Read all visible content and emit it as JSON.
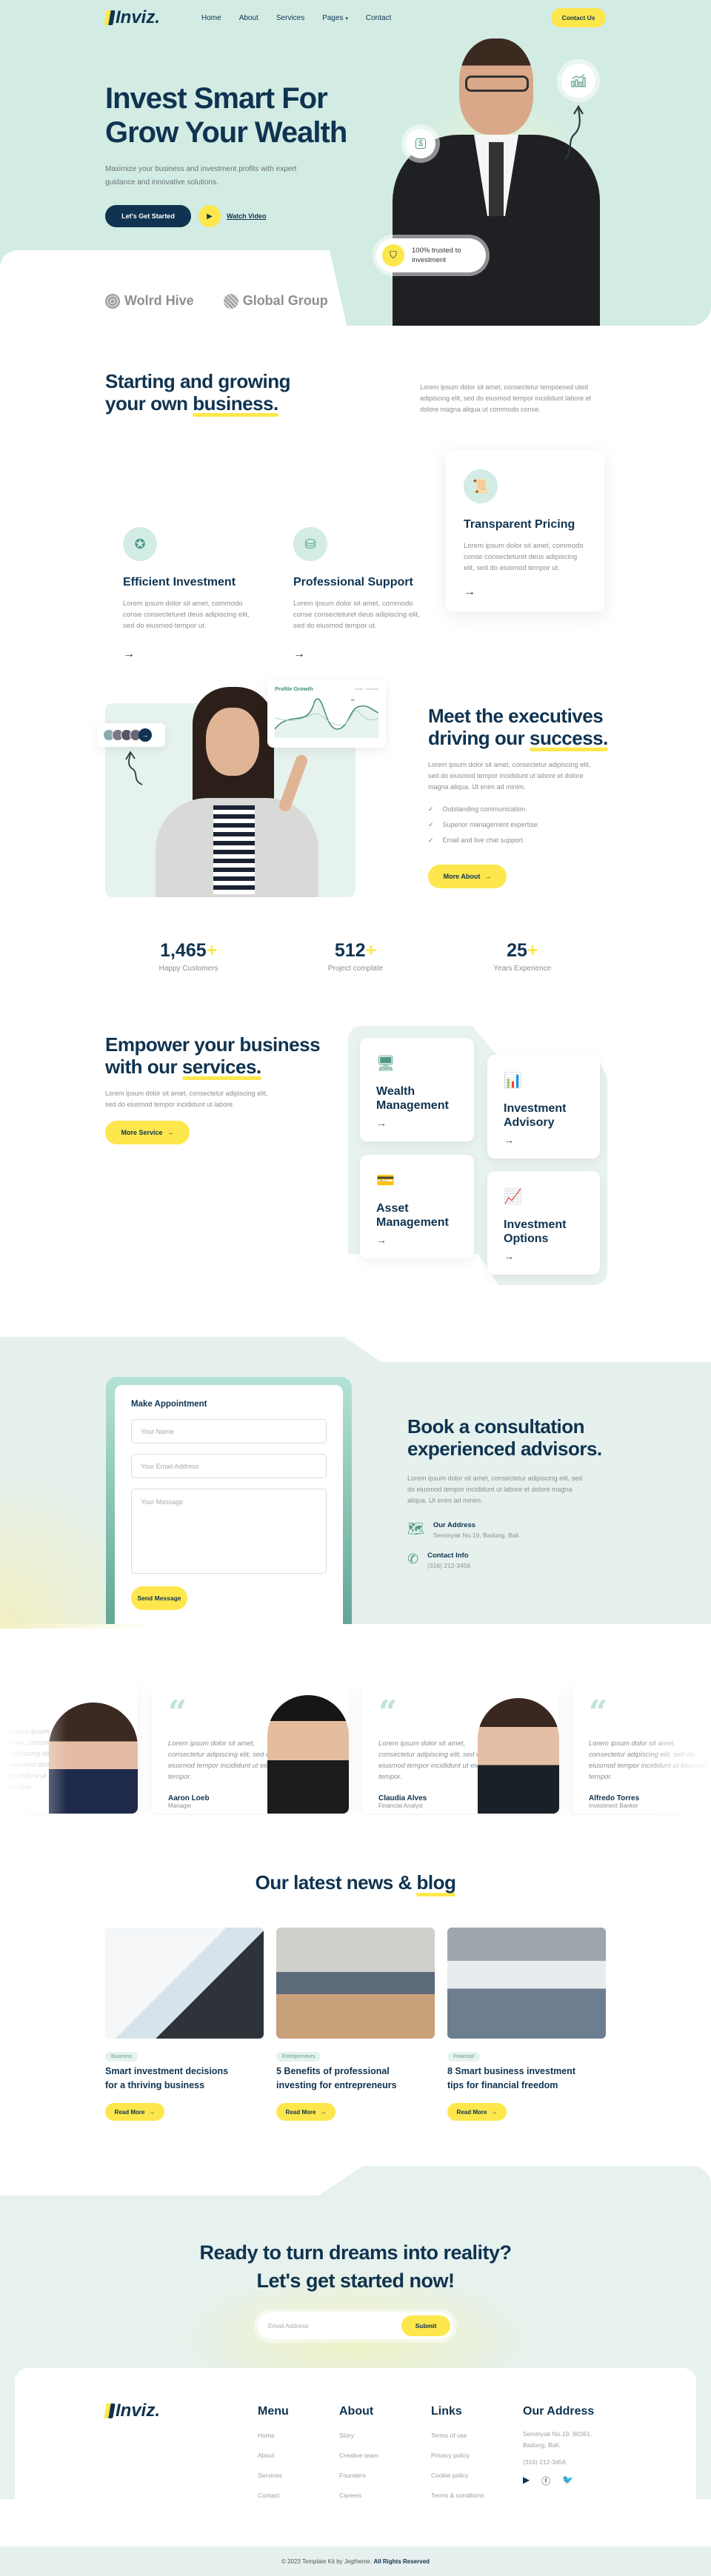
{
  "nav": {
    "brand": "Inviz.",
    "items": [
      "Home",
      "About",
      "Services",
      "Pages",
      "Contact"
    ],
    "cta": "Contact Us"
  },
  "hero": {
    "title_line1": "Invest Smart For",
    "title_line2_pre": "Grow Your ",
    "title_line2_hl": "Wealth",
    "subtitle": "Maximize your business and investment profits with expert guidance and innovative solutions.",
    "primary_btn": "Let's Get Started",
    "video_btn": "Watch Video",
    "trust_badge": "100% trusted to investment",
    "partners": [
      "Wolrd Hive",
      "Global Group"
    ]
  },
  "intro": {
    "title_line1": "Starting and growing",
    "title_line2_pre": "your own ",
    "title_line2_hl": "business.",
    "text": "Lorem ipsum dolor sit amet, consectetur tempoesed uted adipiscing elit, sed do eiusmod tempor incididunt labore et dolore magna aliqua ut commodo conse."
  },
  "features": [
    {
      "title": "Efficient Investment",
      "text": "Lorem ipsum dolor sit amet, commodo conse consecteturet deus adipiscing elit, sed do eiusmod tempor ut.",
      "icon": "laurel-star-icon"
    },
    {
      "title": "Professional Support",
      "text": "Lorem ipsum dolor sit amet, commodo conse consecteturet deus adipiscing elit, sed do eiusmod tempor ut.",
      "icon": "coins-icon"
    },
    {
      "title": "Transparent Pricing",
      "text": "Lorem ipsum dolor sit amet, commodo conse consecteturet deus adipiscing elit, sed do eiusmod tempor ut.",
      "icon": "certificate-icon"
    }
  ],
  "executives": {
    "chart_title": "Profile Growth",
    "chart_legend": [
      "Today",
      "Yesterday"
    ],
    "chart_point_label": "28",
    "title_line1": "Meet the executives",
    "title_line2_pre": "driving our ",
    "title_line2_hl": "success.",
    "text": "Lorem ipsum dolor sit amet, consectetur adipiscing elit, sed do eiusmod tempor incididunt ut labore et dolore magna aliqua. Ut enim ad minim.",
    "checks": [
      "Outstanding communication.",
      "Superior management expertise.",
      "Email and live chat support."
    ],
    "button": "More About"
  },
  "stats": [
    {
      "value": "1,465",
      "suffix": "+",
      "label": "Happy Customers"
    },
    {
      "value": "512",
      "suffix": "+",
      "label": "Project complate"
    },
    {
      "value": "25",
      "suffix": "+",
      "label": "Years Experience"
    }
  ],
  "services": {
    "title_line1": "Empower your business",
    "title_line2_pre": "with our ",
    "title_line2_hl": "services.",
    "text": "Lorem ipsum dolor sit amet, consectetur adipiscing elit, sed do eiusmod tempor incididunt ut labore.",
    "button": "More Service",
    "cards": [
      {
        "title": "Wealth Management",
        "icon": "monitor-dollar-icon"
      },
      {
        "title": "Investment Advisory",
        "icon": "presentation-chart-icon"
      },
      {
        "title": "Asset Management",
        "icon": "credit-card-icon"
      },
      {
        "title": "Investment Options",
        "icon": "growth-chart-icon"
      }
    ]
  },
  "appointment": {
    "form_title": "Make Appointment",
    "name_placeholder": "Your Name",
    "email_placeholder": "Your Email Address",
    "message_placeholder": "Your Massage",
    "submit": "Send Message",
    "title_line1_pre": "Book a ",
    "title_line1_hl": "consultation",
    "title_line2": "experienced advisors.",
    "text": "Lorem ipsum dolor sit amet, consectetur adipiscing elit, sed do eiusmod tempor incididunt ut labore et dolore magna aliqua. Ut enim ad minim.",
    "address_label": "Our Address",
    "address_value": "Seminyak No.19, Badung, Bali.",
    "contact_label": "Contact Info",
    "contact_value": "(316) 212-3456"
  },
  "testimonials": [
    {
      "quote": "Lorem ipsum dolor sit amet, consectetur adipiscing elit, sed do eiusmod tempor incididunt ut eiusmod tempor.",
      "name": "",
      "role": ""
    },
    {
      "quote": "Lorem ipsum dolor sit amet, consectetur adipiscing elit, sed do eiusmod tempor incididunt ut eiusmod tempor.",
      "name": "Aaron Loeb",
      "role": "Manager"
    },
    {
      "quote": "Lorem ipsum dolor sit amet, consectetur adipiscing elit, sed do eiusmod tempor incididunt ut eiusmod tempor.",
      "name": "Claudia Alves",
      "role": "Financial Analyst"
    },
    {
      "quote": "Lorem ipsum dolor sit amet, consectetur adipiscing elit, sed do eiusmod tempor incididunt ut eiusmod tempor.",
      "name": "Alfredo Torres",
      "role": "Investment Banker"
    }
  ],
  "blog": {
    "title_pre": "Our latest news & ",
    "title_hl": "blog",
    "read_more": "Read More",
    "posts": [
      {
        "tag": "Business",
        "title": "Smart investment decisions for a thriving business"
      },
      {
        "tag": "Entrepreneurs",
        "title": "5 Benefits of professional investing for entrepreneurs"
      },
      {
        "tag": "Financial",
        "title": "8 Smart business investment tips for financial freedom"
      }
    ]
  },
  "cta": {
    "line1": "Ready to turn dreams into reality?",
    "line2_pre": "Let's get started ",
    "line2_hl": "now!",
    "email_placeholder": "Email Address",
    "submit": "Submit"
  },
  "footer": {
    "brand": "Inviz.",
    "columns": [
      {
        "title": "Menu",
        "links": [
          "Home",
          "About",
          "Services",
          "Contact"
        ]
      },
      {
        "title": "About",
        "links": [
          "Story",
          "Creative team",
          "Founders",
          "Careers"
        ]
      },
      {
        "title": "Links",
        "links": [
          "Terms of use",
          "Privacy policy",
          "Cookie policy",
          "Terms & conditions"
        ]
      }
    ],
    "address_title": "Our Address",
    "address": "Seminyak No.19, 80361, Badung, Bali.",
    "phone": "(316) 212-3456",
    "social": [
      "youtube-icon",
      "facebook-icon",
      "twitter-icon"
    ],
    "copyright": "© 2023 Template Kit by Jegtheme.",
    "rights": "All Rights Reserved"
  },
  "colors": {
    "navy": "#0f3350",
    "yellow": "#fde74c",
    "mint": "#d2ece4",
    "teal": "#5f9c8d"
  }
}
